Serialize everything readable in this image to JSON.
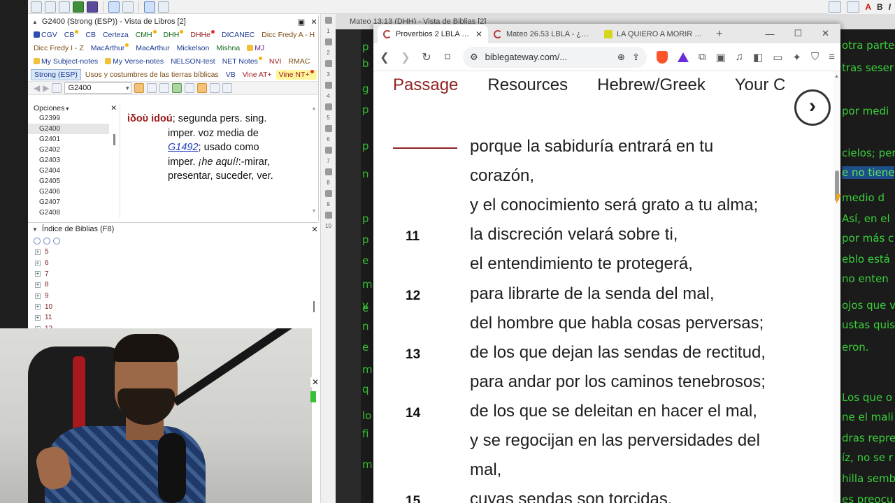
{
  "esword": {
    "libros_panel": {
      "title": "G2400 (Strong (ESP)) - Vista de Libros [2]",
      "tabs_row1": [
        {
          "label": "CGV",
          "color": "blue",
          "icon": "search-icon"
        },
        {
          "label": "CB",
          "color": "blue",
          "dot": true
        },
        {
          "label": "CB",
          "color": "blue"
        },
        {
          "label": "Certeza",
          "color": "blue"
        },
        {
          "label": "CMH",
          "color": "green",
          "dot": true
        },
        {
          "label": "DHH",
          "color": "green",
          "dot": true
        },
        {
          "label": "DHHe",
          "color": "red",
          "dot": true
        },
        {
          "label": "DICANEC",
          "color": "blue"
        },
        {
          "label": "Dicc Fredy A - H",
          "color": "brown"
        }
      ],
      "tabs_row2": [
        {
          "label": "Dicc Fredy I - Z",
          "color": "brown"
        },
        {
          "label": "MacArthur",
          "color": "blue",
          "dot": true
        },
        {
          "label": "MacArthur",
          "color": "blue"
        },
        {
          "label": "Mickelson",
          "color": "blue"
        },
        {
          "label": "Mishna",
          "color": "green"
        },
        {
          "label": "MJ",
          "color": "purple",
          "icon": "note-icon"
        }
      ],
      "tabs_row3": [
        {
          "label": "My Subject-notes",
          "color": "blue",
          "icon": "note-icon"
        },
        {
          "label": "My Verse-notes",
          "color": "blue",
          "icon": "note-icon"
        },
        {
          "label": "NELSON-test",
          "color": "blue"
        },
        {
          "label": "NET Notes",
          "color": "blue",
          "dot": true
        },
        {
          "label": "NVI",
          "color": "red"
        },
        {
          "label": "RMAC",
          "color": "brown"
        }
      ],
      "tabs_row4": [
        {
          "label": "Strong (ESP)",
          "color": "blue",
          "active": true
        },
        {
          "label": "Usos y costumbres de las tierras bíblicas",
          "color": "brown"
        },
        {
          "label": "VB",
          "color": "blue"
        },
        {
          "label": "Vine AT+",
          "color": "red"
        },
        {
          "label": "Vine NT+",
          "color": "red",
          "dot": true,
          "yellow": true
        }
      ],
      "nav_combo": "G2400",
      "opciones_label": "Opciones",
      "opciones_items": [
        "G2399",
        "G2400",
        "G2401",
        "G2402",
        "G2403",
        "G2404",
        "G2405",
        "G2406",
        "G2407",
        "G2408"
      ],
      "selected_item": "G2400",
      "definition": {
        "greek": "ἰδοὺ idoú",
        "part1": "; segunda pers. sing.",
        "line2": "imper. voz media de",
        "link": "G1492",
        "part3": "; usado como",
        "line4a": "imper. ",
        "italic": "¡he aquí!",
        "line4b": ":-mirar,",
        "line5": "presentar, suceder, ver."
      }
    },
    "indice_panel": {
      "title": "Índice de Biblias (F8)",
      "items": [
        "5",
        "6",
        "7",
        "8",
        "9",
        "10",
        "11",
        "12"
      ]
    },
    "bible_view_title": "Mateo 13:13 (DHH) - Vista de Biblias [2]",
    "left_fragments": [
      "p",
      "b",
      "g",
      "p",
      "p",
      "n",
      "p",
      "p",
      "e",
      "m",
      "e",
      "v",
      "n",
      "e",
      "m",
      "q",
      "lo",
      "fi",
      "m"
    ],
    "right_fragments": [
      "otra parte",
      "tras seser",
      "por medi",
      "cielos; per",
      "e no tiene",
      "medio d",
      "Así, en el",
      "por más c",
      "eblo está",
      "no enten",
      "ojos que v",
      "ustas quis",
      "eron.",
      "Los que o",
      "ne el mali",
      "dras repre",
      "íz, no se r",
      "hilla semb",
      "es preocu"
    ],
    "mid_numbers": [
      "1",
      "2",
      "3",
      "4",
      "5",
      "6",
      "7",
      "8",
      "9",
      "10"
    ]
  },
  "browser": {
    "tabs": [
      {
        "title": "Proverbios 2 LBLA - Bible Gateway",
        "active": true
      },
      {
        "title": "Mateo 26.53 LBLA - ¿O p",
        "active": false
      },
      {
        "title": "LA QUIERO A MORIR - F",
        "active": false
      }
    ],
    "url": "biblegateway.com/...",
    "page_nav": [
      "Passage",
      "Resources",
      "Hebrew/Greek",
      "Your C"
    ],
    "verses": [
      {
        "num": "",
        "text": "porque la sabiduría entrará en tu"
      },
      {
        "num": "",
        "text": "corazón,"
      },
      {
        "num": "",
        "text": "y el conocimiento será grato a tu alma;"
      },
      {
        "num": "11",
        "text": "la discreción velará sobre ti,"
      },
      {
        "num": "",
        "text": "el entendimiento te protegerá,"
      },
      {
        "num": "12",
        "text": "para librarte de la senda del mal,"
      },
      {
        "num": "",
        "text": "del hombre que habla cosas perversas;"
      },
      {
        "num": "13",
        "text": "de los que dejan las sendas de rectitud,"
      },
      {
        "num": "",
        "text": "para andar por los caminos tenebrosos;"
      },
      {
        "num": "14",
        "text": "de los que se deleitan en hacer el mal,"
      },
      {
        "num": "",
        "text": "y se regocijan en las perversidades del"
      },
      {
        "num": "",
        "text": "mal,"
      },
      {
        "num": "15",
        "text": "cuyas sendas son torcidas,"
      }
    ]
  },
  "colors": {
    "accent_red": "#8f2424",
    "greek_red": "#9b1a1a",
    "link_blue": "#1f3fbf",
    "terminal_green": "#3ad13a"
  }
}
